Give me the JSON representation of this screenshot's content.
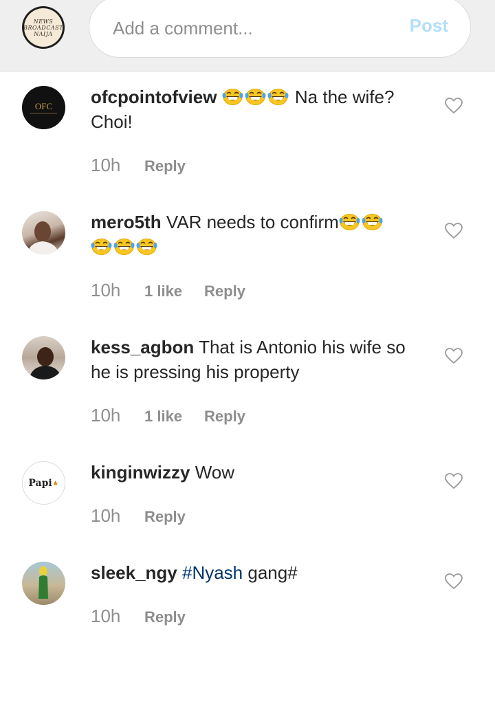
{
  "composer": {
    "placeholder": "Add a comment...",
    "post_label": "Post",
    "avatar_text": [
      "NEWS",
      "BROADCAST",
      "NAIJA"
    ]
  },
  "comments": [
    {
      "username": "ofcpointofview",
      "text": "Na the wife? Choi!",
      "emoji": "grinning-squinting-face x3",
      "time": "10h",
      "likes": "",
      "reply": "Reply"
    },
    {
      "username": "mero5th",
      "text": "VAR needs to confirm",
      "emoji": "grinning-squinting-face x5",
      "time": "10h",
      "likes": "1 like",
      "reply": "Reply"
    },
    {
      "username": "kess_agbon",
      "text": "That is Antonio his wife so he is pressing his property",
      "time": "10h",
      "likes": "1 like",
      "reply": "Reply"
    },
    {
      "username": "kinginwizzy",
      "text": "Wow",
      "avatar_text": "Papi",
      "time": "10h",
      "likes": "",
      "reply": "Reply"
    },
    {
      "username": "sleek_ngy",
      "hashtag": "#Nyash",
      "text": "gang#",
      "time": "10h",
      "likes": "",
      "reply": "Reply"
    }
  ],
  "colors": {
    "post_disabled": "#b2dffc",
    "hashtag": "#003569",
    "meta": "#8e8e8e"
  }
}
